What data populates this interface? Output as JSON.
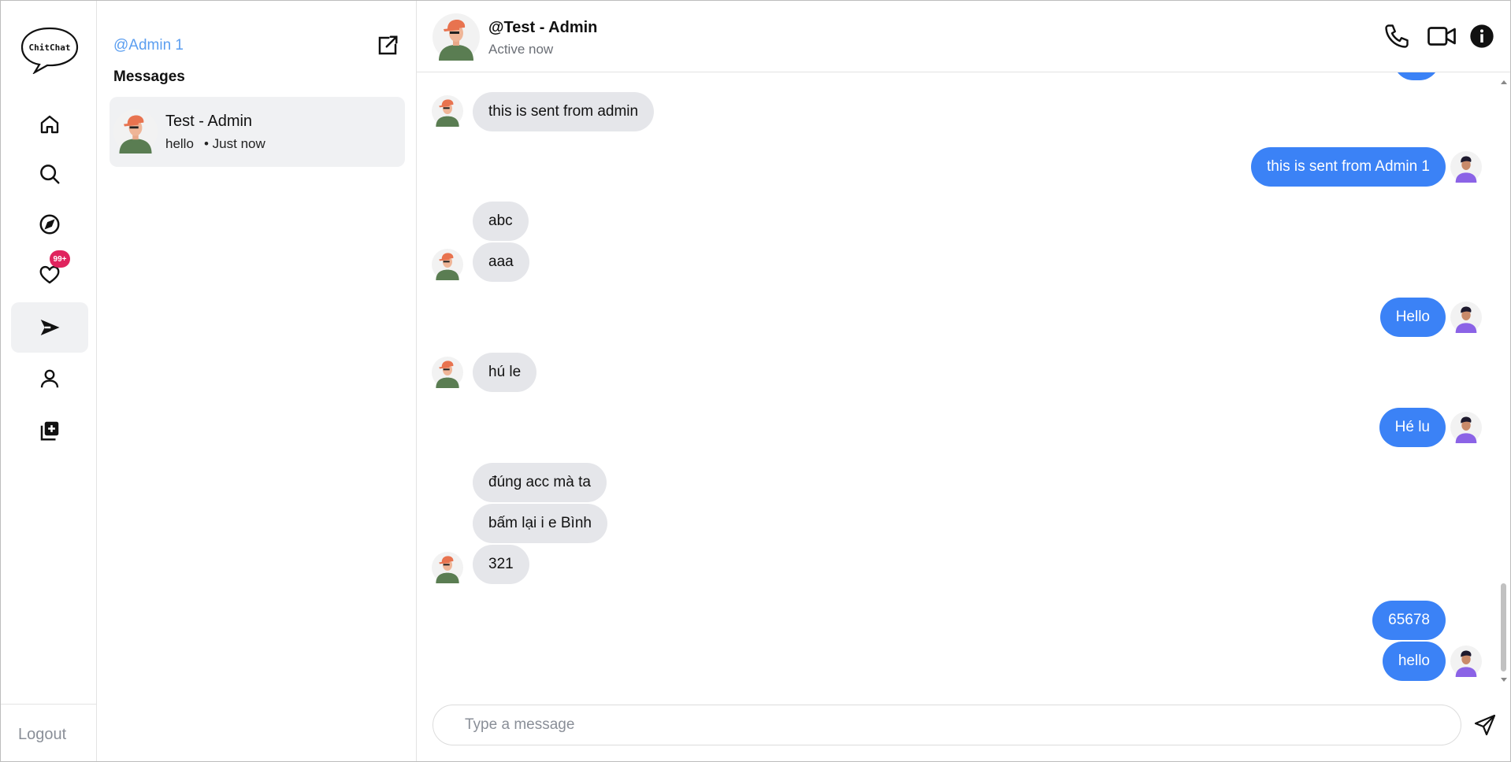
{
  "app": {
    "logo_text": "ChitChat"
  },
  "nav": {
    "items": [
      {
        "name": "home",
        "icon": "home-icon"
      },
      {
        "name": "search",
        "icon": "search-icon"
      },
      {
        "name": "explore",
        "icon": "compass-icon"
      },
      {
        "name": "notifications",
        "icon": "heart-icon",
        "badge": "99+"
      },
      {
        "name": "messages",
        "icon": "send-icon",
        "active": true
      },
      {
        "name": "profile",
        "icon": "user-icon"
      },
      {
        "name": "create",
        "icon": "add-post-icon"
      }
    ],
    "logout_label": "Logout"
  },
  "sidebar": {
    "username": "@Admin 1",
    "heading": "Messages",
    "conversations": [
      {
        "name": "Test - Admin",
        "preview": "hello",
        "time": "• Just now"
      }
    ]
  },
  "chat": {
    "title": "@Test - Admin",
    "status": "Active now",
    "messages": [
      {
        "from": "them",
        "text": "this is sent from admin"
      },
      {
        "from": "me",
        "text": "this is sent from Admin 1"
      },
      {
        "from": "them",
        "text": "abc"
      },
      {
        "from": "them",
        "text": "aaa"
      },
      {
        "from": "me",
        "text": "Hello"
      },
      {
        "from": "them",
        "text": "hú le"
      },
      {
        "from": "me",
        "text": "Hé lu"
      },
      {
        "from": "them",
        "text": "đúng acc mà ta"
      },
      {
        "from": "them",
        "text": "bấm lại i e Bình"
      },
      {
        "from": "them",
        "text": "321"
      },
      {
        "from": "me",
        "text": "65678"
      },
      {
        "from": "me",
        "text": "hello"
      }
    ],
    "input_placeholder": "Type a message",
    "input_value": ""
  },
  "colors": {
    "accent": "#3b82f6",
    "incoming_bubble": "#e5e6ea",
    "badge": "#e0245e",
    "link": "#5b9ef0"
  }
}
